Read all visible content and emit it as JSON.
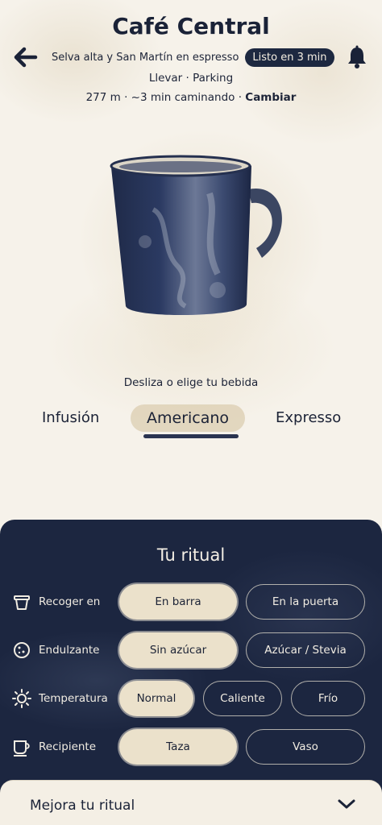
{
  "header": {
    "title": "Café Central",
    "subtitle": "Selva alta y San Martín en espresso",
    "ready_badge": "Listo en 3 min",
    "order_mode": "Llevar · Parking",
    "distance": "277 m · ~3 min caminando · ",
    "change_label": "Cambiar"
  },
  "icons": {
    "back": "arrow-left-icon",
    "bell": "bell-icon",
    "pickup": "takeaway-cup-icon",
    "sweetener": "cookie-icon",
    "temperature": "sun-icon",
    "vessel": "mug-icon",
    "expand": "chevron-down-icon"
  },
  "hero": {
    "image": "watercolor-mug-illustration",
    "hint": "Desliza o elige tu bebida"
  },
  "drinks": {
    "tabs": [
      "Infusión",
      "Americano",
      "Expresso"
    ],
    "selected": "Americano"
  },
  "ritual": {
    "title": "Tu ritual",
    "rows": [
      {
        "label": "Recoger en",
        "options": [
          "En barra",
          "En la puerta"
        ],
        "selected": "En barra"
      },
      {
        "label": "Endulzante",
        "options": [
          "Sin azúcar",
          "Azúcar / Stevia"
        ],
        "selected": "Sin azúcar"
      },
      {
        "label": "Temperatura",
        "options": [
          "Normal",
          "Caliente",
          "Frío"
        ],
        "selected": "Normal"
      },
      {
        "label": "Recipiente",
        "options": [
          "Taza",
          "Vaso"
        ],
        "selected": "Taza"
      }
    ]
  },
  "improve": {
    "label": "Mejora tu ritual"
  },
  "colors": {
    "ink": "#1c2640",
    "paper": "#f4efe5",
    "selected_pill": "#ebe1cb"
  }
}
